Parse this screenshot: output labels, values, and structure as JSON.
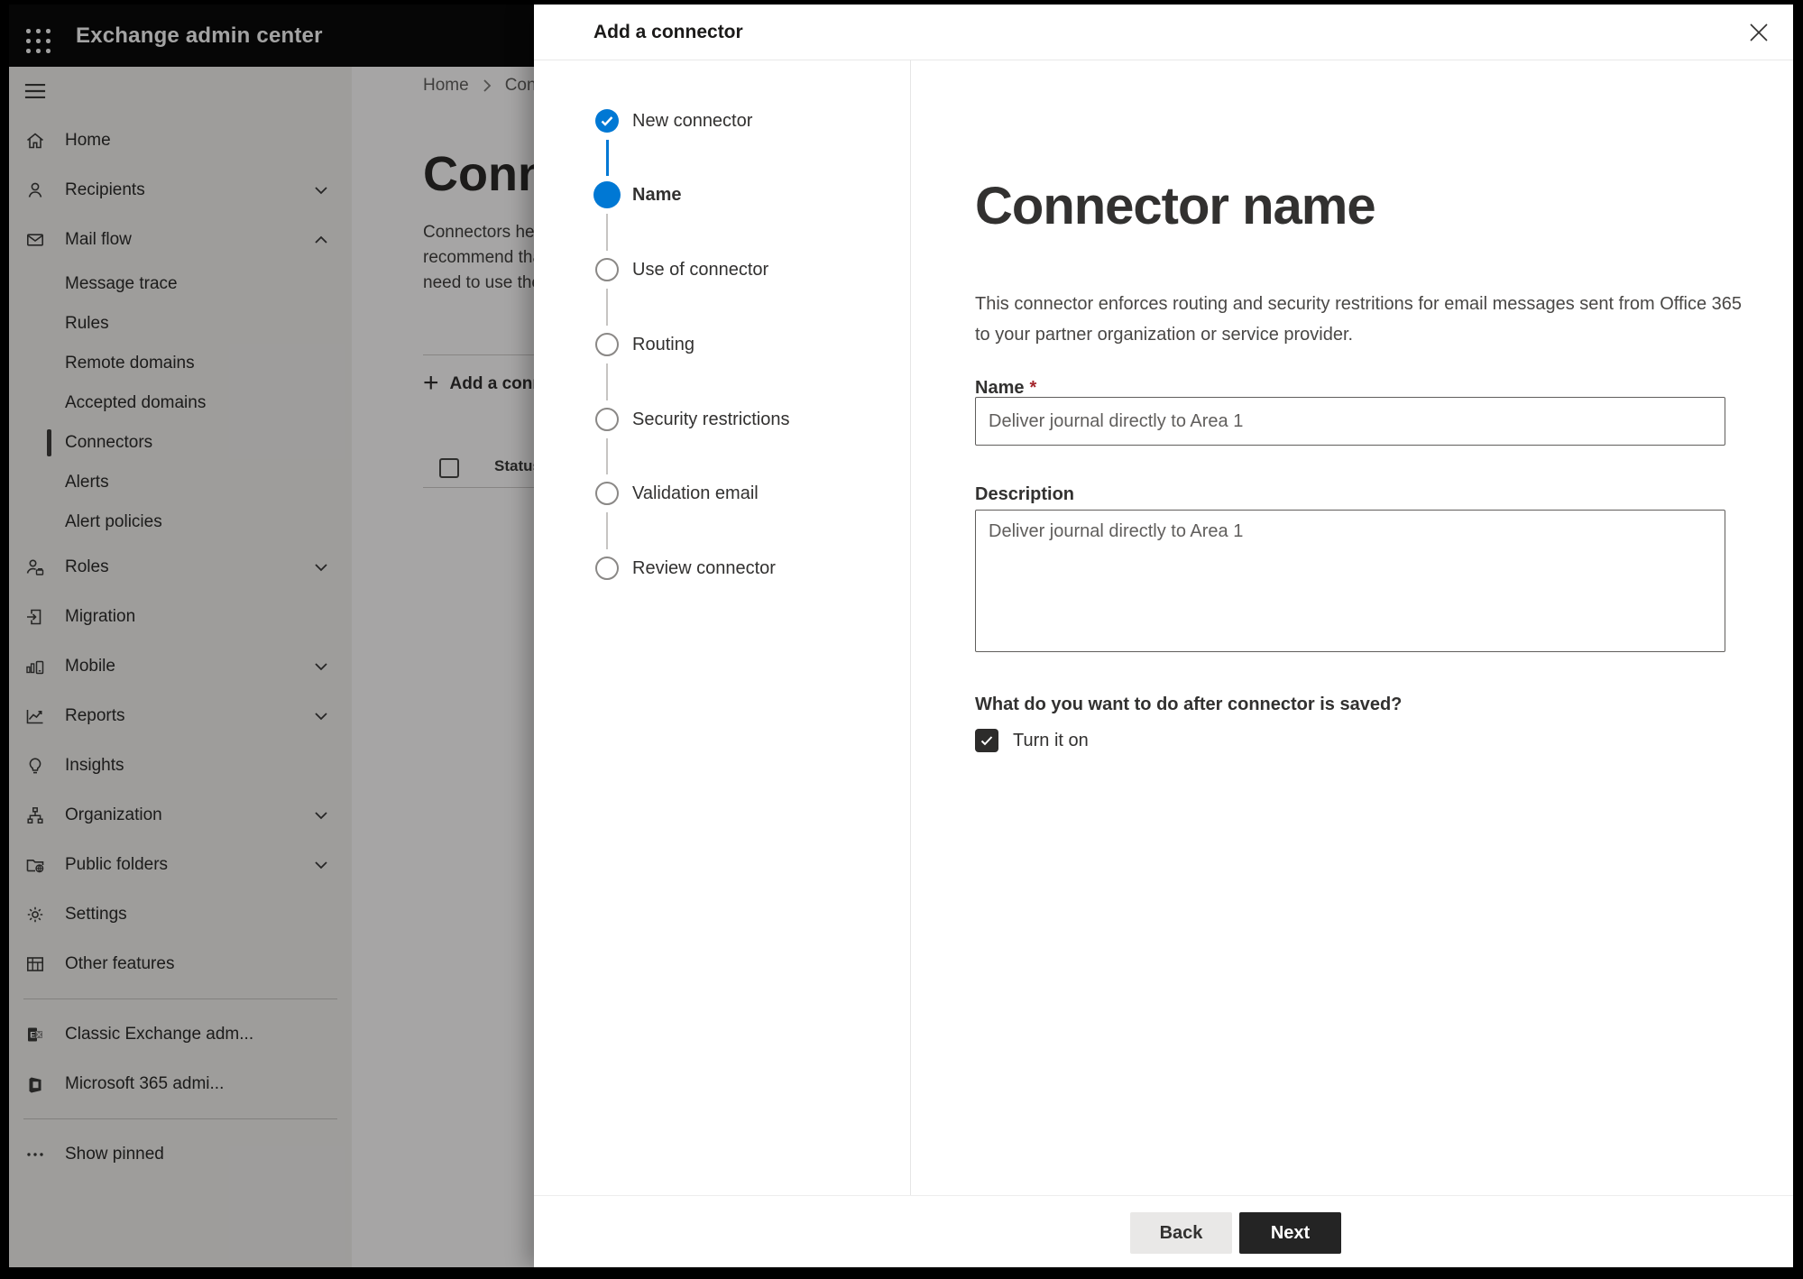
{
  "app": {
    "title": "Exchange admin center"
  },
  "sidebar": {
    "items": [
      {
        "kind": "burger",
        "icon": "hamburger"
      },
      {
        "kind": "main",
        "label": "Home",
        "icon": "home"
      },
      {
        "kind": "main",
        "label": "Recipients",
        "icon": "person",
        "chevron": "down"
      },
      {
        "kind": "main",
        "label": "Mail flow",
        "icon": "mail",
        "chevron": "up"
      },
      {
        "kind": "sub",
        "label": "Message trace"
      },
      {
        "kind": "sub",
        "label": "Rules"
      },
      {
        "kind": "sub",
        "label": "Remote domains"
      },
      {
        "kind": "sub",
        "label": "Accepted domains"
      },
      {
        "kind": "sub",
        "label": "Connectors",
        "selected": true
      },
      {
        "kind": "sub",
        "label": "Alerts"
      },
      {
        "kind": "sub",
        "label": "Alert policies"
      },
      {
        "kind": "main",
        "label": "Roles",
        "icon": "roles",
        "chevron": "down"
      },
      {
        "kind": "main",
        "label": "Migration",
        "icon": "migration"
      },
      {
        "kind": "main",
        "label": "Mobile",
        "icon": "mobile",
        "chevron": "down"
      },
      {
        "kind": "main",
        "label": "Reports",
        "icon": "reports",
        "chevron": "down"
      },
      {
        "kind": "main",
        "label": "Insights",
        "icon": "insights"
      },
      {
        "kind": "main",
        "label": "Organization",
        "icon": "organization",
        "chevron": "down"
      },
      {
        "kind": "main",
        "label": "Public folders",
        "icon": "public-folders",
        "chevron": "down"
      },
      {
        "kind": "main",
        "label": "Settings",
        "icon": "settings"
      },
      {
        "kind": "main",
        "label": "Other features",
        "icon": "other-features"
      },
      {
        "kind": "divider"
      },
      {
        "kind": "main",
        "label": "Classic Exchange adm...",
        "icon": "exchange"
      },
      {
        "kind": "main",
        "label": "Microsoft 365 admi...",
        "icon": "m365"
      },
      {
        "kind": "divider"
      },
      {
        "kind": "main",
        "label": "Show pinned",
        "icon": "ellipsis"
      }
    ]
  },
  "background": {
    "breadcrumb": {
      "home": "Home",
      "current": "Conne"
    },
    "page_title": "Connect",
    "intro_lines": [
      "Connectors help",
      "recommend that",
      "need to use ther"
    ],
    "add_button_label": "Add a conn",
    "status_header": "Status"
  },
  "modal": {
    "title": "Add a connector",
    "steps": [
      {
        "label": "New connector",
        "state": "completed"
      },
      {
        "label": "Name",
        "state": "current"
      },
      {
        "label": "Use of connector",
        "state": "upcoming"
      },
      {
        "label": "Routing",
        "state": "upcoming"
      },
      {
        "label": "Security restrictions",
        "state": "upcoming"
      },
      {
        "label": "Validation email",
        "state": "upcoming"
      },
      {
        "label": "Review connector",
        "state": "upcoming"
      }
    ],
    "content": {
      "heading": "Connector name",
      "description_line1": "This connector enforces routing and security restritions for email messages sent from Office 365",
      "description_line2": "to your partner organization or service provider.",
      "name_label": "Name",
      "name_required_marker": "*",
      "name_value": "Deliver journal directly to Area 1",
      "description_label": "Description",
      "description_value": "Deliver journal directly to Area 1",
      "after_save_question": "What do you want to do after connector is saved?",
      "turn_on_label": "Turn it on",
      "turn_on_checked": true
    },
    "footer": {
      "back_label": "Back",
      "next_label": "Next"
    }
  },
  "colors": {
    "accent": "#0078d4",
    "topbar": "#0a0a0a",
    "required_marker": "#a4262c",
    "next_button": "#242424",
    "step_upcoming_border": "#8a8886",
    "step_line_gray": "#c6c4c2"
  }
}
